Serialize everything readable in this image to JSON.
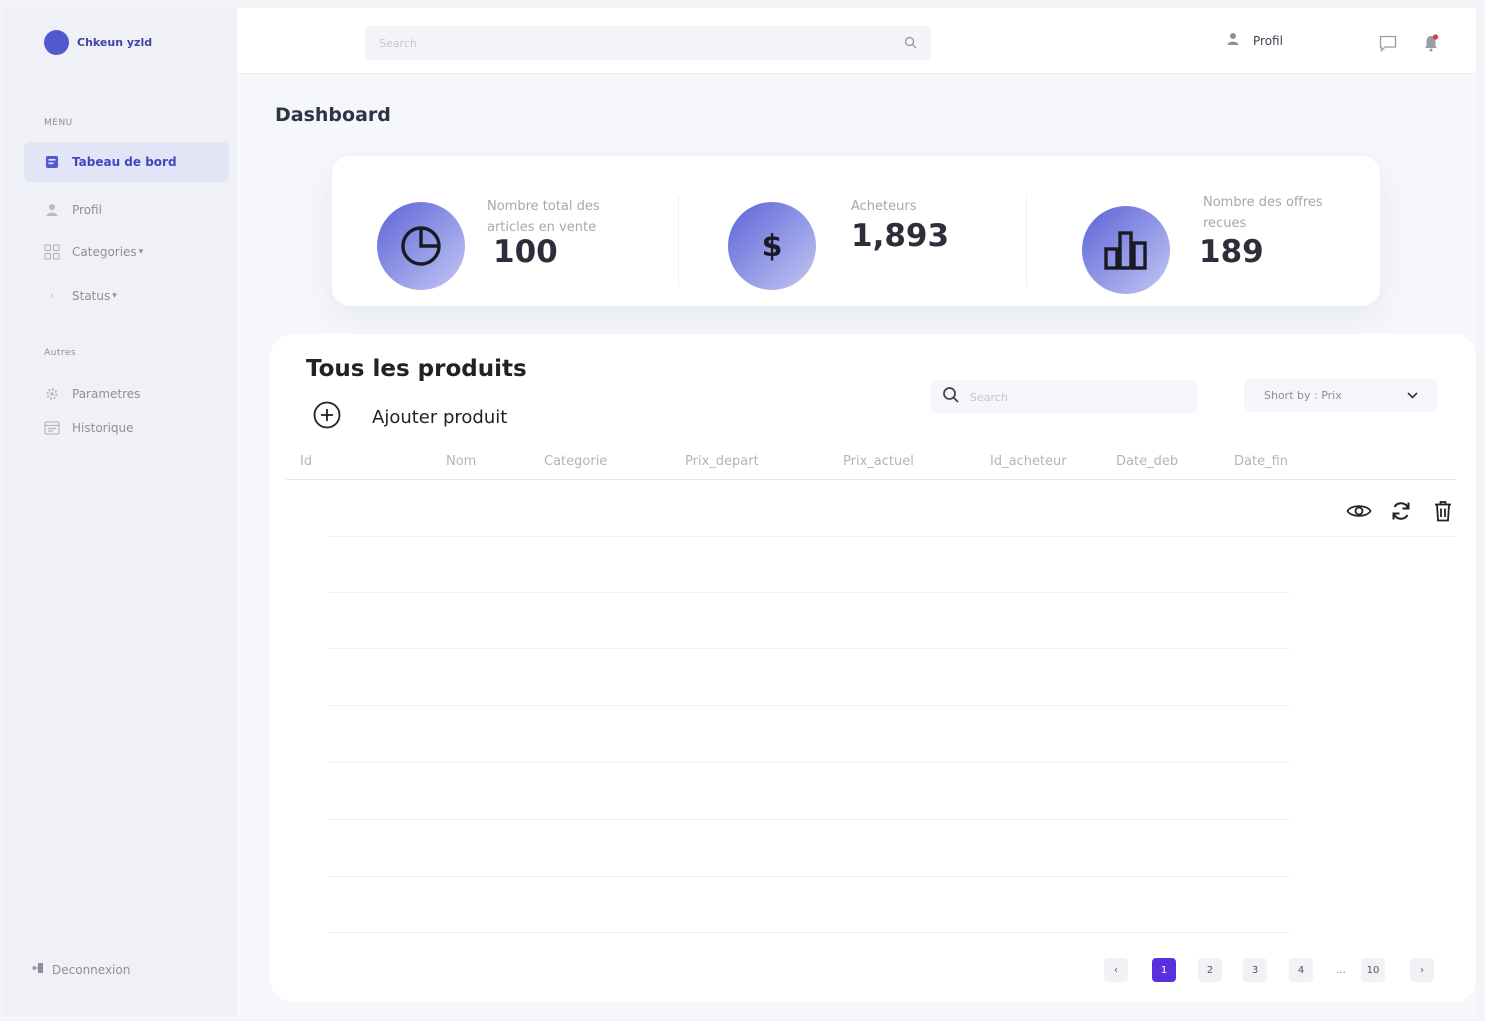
{
  "brand": {
    "name": "Chkeun yzld"
  },
  "sidebar": {
    "menu_title": "MENU",
    "items": [
      {
        "label": "Tabeau de bord",
        "icon": "dashboard-icon",
        "active": true
      },
      {
        "label": "Profil",
        "icon": "user-icon",
        "active": false
      },
      {
        "label": "Categories",
        "icon": "grid-icon",
        "active": false
      },
      {
        "label": "Status",
        "icon": "chevron-right-icon",
        "active": false
      }
    ],
    "other_title": "Autres",
    "other_items": [
      {
        "label": "Parametres",
        "icon": "gear-icon"
      },
      {
        "label": "Historique",
        "icon": "history-icon"
      }
    ],
    "logout_label": "Deconnexion"
  },
  "topbar": {
    "search_placeholder": "Search",
    "profile_label": "Profil"
  },
  "page": {
    "title": "Dashboard"
  },
  "stats": [
    {
      "label": "Nombre total des articles en vente",
      "value": "100",
      "icon": "pie-chart-icon"
    },
    {
      "label": "Acheteurs",
      "value": "1,893",
      "icon": "dollar-icon"
    },
    {
      "label": "Nombre des offres recues",
      "value": "189",
      "icon": "bar-chart-icon"
    }
  ],
  "products": {
    "title": "Tous les produits",
    "add_label": "Ajouter produit",
    "search_placeholder": "Search",
    "sort_label": "Short by : Prix",
    "columns": [
      "Id",
      "Nom",
      "Categorie",
      "Prix_depart",
      "Prix_actuel",
      "Id_acheteur",
      "Date_deb",
      "Date_fin"
    ]
  },
  "pagination": {
    "prev": "‹",
    "pages": [
      "1",
      "2",
      "3",
      "4"
    ],
    "ellipsis": "...",
    "last": "10",
    "next": "›",
    "current": "1"
  },
  "colors": {
    "accent": "#5159cf",
    "active_page": "#5a2fe0",
    "notification": "#e53935"
  }
}
